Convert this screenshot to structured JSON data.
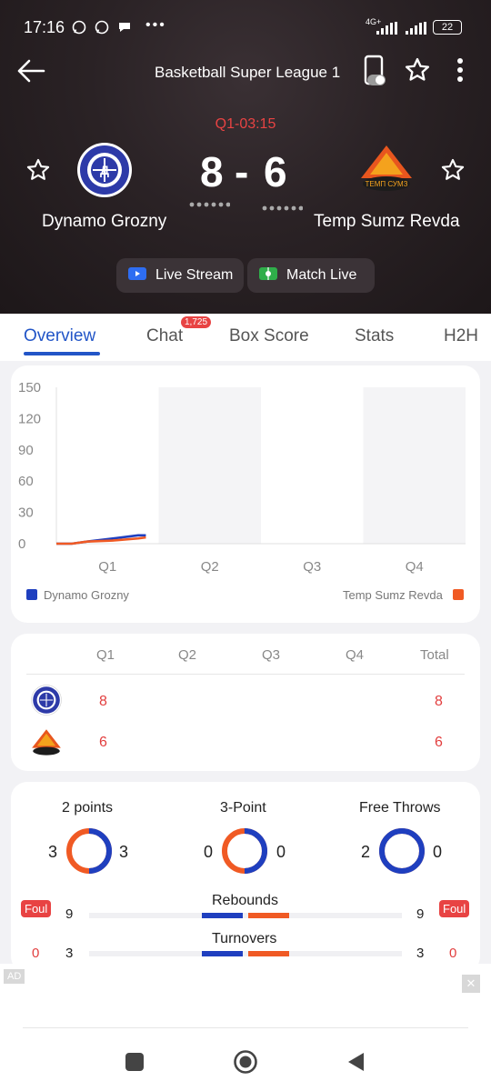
{
  "status_bar": {
    "time": "17:16",
    "overflow": "•••",
    "network": "4G+",
    "battery": "22",
    "icons": [
      "whatsapp-icon",
      "whatsapp-icon",
      "message-icon",
      "signal-icon",
      "signal-icon",
      "battery-icon"
    ]
  },
  "header": {
    "title": "Basketball Super League 1",
    "period_clock": "Q1-03:15",
    "home": {
      "name": "Dynamo Grozny",
      "score": "8"
    },
    "away": {
      "name": "Temp Sumz Revda",
      "score": "6"
    },
    "score_separator": "-",
    "live_stream_label": "Live Stream",
    "match_live_label": "Match Live"
  },
  "tabs": [
    {
      "label": "Overview",
      "active": true
    },
    {
      "label": "Chat",
      "badge": "1,725"
    },
    {
      "label": "Box Score"
    },
    {
      "label": "Stats"
    },
    {
      "label": "H2H"
    }
  ],
  "chart_data": {
    "type": "line",
    "categories": [
      "Q1",
      "Q2",
      "Q3",
      "Q4"
    ],
    "y_ticks": [
      "150",
      "120",
      "90",
      "60",
      "30",
      "0"
    ],
    "ylim": [
      0,
      150
    ],
    "series": [
      {
        "name": "Dynamo Grozny",
        "color": "#1f3fbf",
        "x": [
          0,
          1.5,
          3,
          5.5,
          8,
          8.75
        ],
        "values": [
          0,
          0,
          2,
          5,
          8,
          8
        ]
      },
      {
        "name": "Temp Sumz Revda",
        "color": "#f05a24",
        "x": [
          0,
          1.5,
          3,
          5.5,
          8,
          8.75
        ],
        "values": [
          0,
          0,
          2,
          3,
          5,
          6
        ]
      }
    ],
    "quarter_length_min": 10,
    "legend": "bottom"
  },
  "score_table": {
    "headers": [
      "Q1",
      "Q2",
      "Q3",
      "Q4",
      "Total"
    ],
    "rows": [
      {
        "team": "Dynamo Grozny",
        "q1": "8",
        "q2": "",
        "q3": "",
        "q4": "",
        "total": "8"
      },
      {
        "team": "Temp Sumz Revda",
        "q1": "6",
        "q2": "",
        "q3": "",
        "q4": "",
        "total": "6"
      }
    ]
  },
  "stats": {
    "rings": [
      {
        "title": "2 points",
        "home": "3",
        "away": "3",
        "home_share": 0.5
      },
      {
        "title": "3-Point",
        "home": "0",
        "away": "0",
        "home_share": 0.5
      },
      {
        "title": "Free Throws",
        "home": "2",
        "away": "0",
        "home_share": 1.0
      }
    ],
    "bars": [
      {
        "title": "Rebounds",
        "home": "9",
        "away": "9",
        "home_share": 0.5
      },
      {
        "title": "Turnovers",
        "home": "3",
        "away": "3",
        "home_share": 0.5
      }
    ],
    "foul_label": "Foul",
    "fouls_home": "0",
    "fouls_away": "0"
  },
  "ad": {
    "label": "AD",
    "close": "✕"
  },
  "colors": {
    "home": "#1f3fbf",
    "away": "#f05a24",
    "accent": "#2255c7",
    "red": "#e23e3e"
  }
}
